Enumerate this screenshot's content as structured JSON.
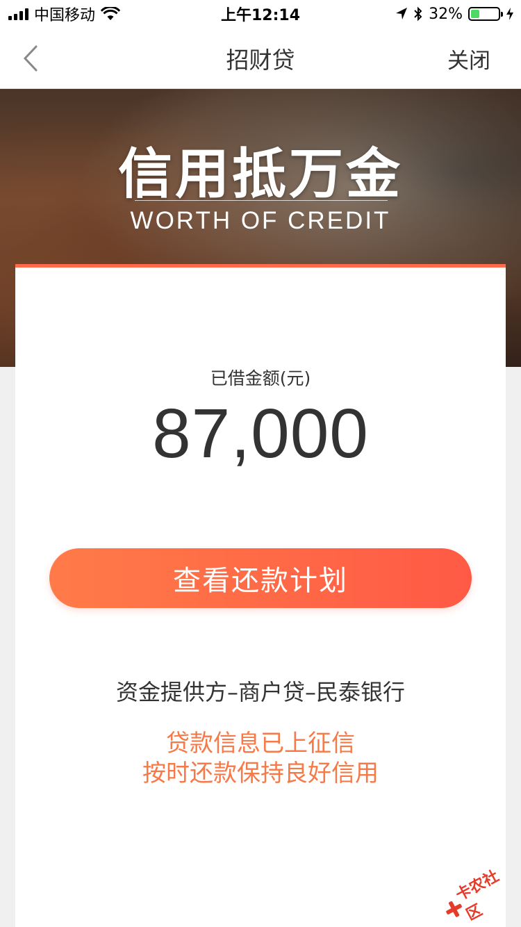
{
  "status_bar": {
    "carrier": "中国移动",
    "time": "上午12:14",
    "battery_percent": "32%",
    "battery_level": 0.32,
    "icons": [
      "signal-icon",
      "wifi-icon",
      "location-icon",
      "bluetooth-icon",
      "battery-icon",
      "charging-icon"
    ]
  },
  "nav": {
    "title": "招财贷",
    "close_label": "关闭",
    "back_icon": "chevron-left-icon"
  },
  "banner": {
    "title": "信用抵万金",
    "subtitle": "WORTH OF CREDIT"
  },
  "loan": {
    "amount_label": "已借金额(元)",
    "amount_value": "87,000",
    "plan_button_label": "查看还款计划",
    "provider_text": "资金提供方–商户贷–民泰银行",
    "notice_line1": "贷款信息已上征信",
    "notice_line2": "按时还款保持良好信用"
  },
  "watermark": {
    "text": "卡农社区"
  },
  "colors": {
    "accent": "#ff5a45",
    "accent_start": "#ff7b48",
    "notice": "#f57a48",
    "battery": "#4cd964"
  }
}
